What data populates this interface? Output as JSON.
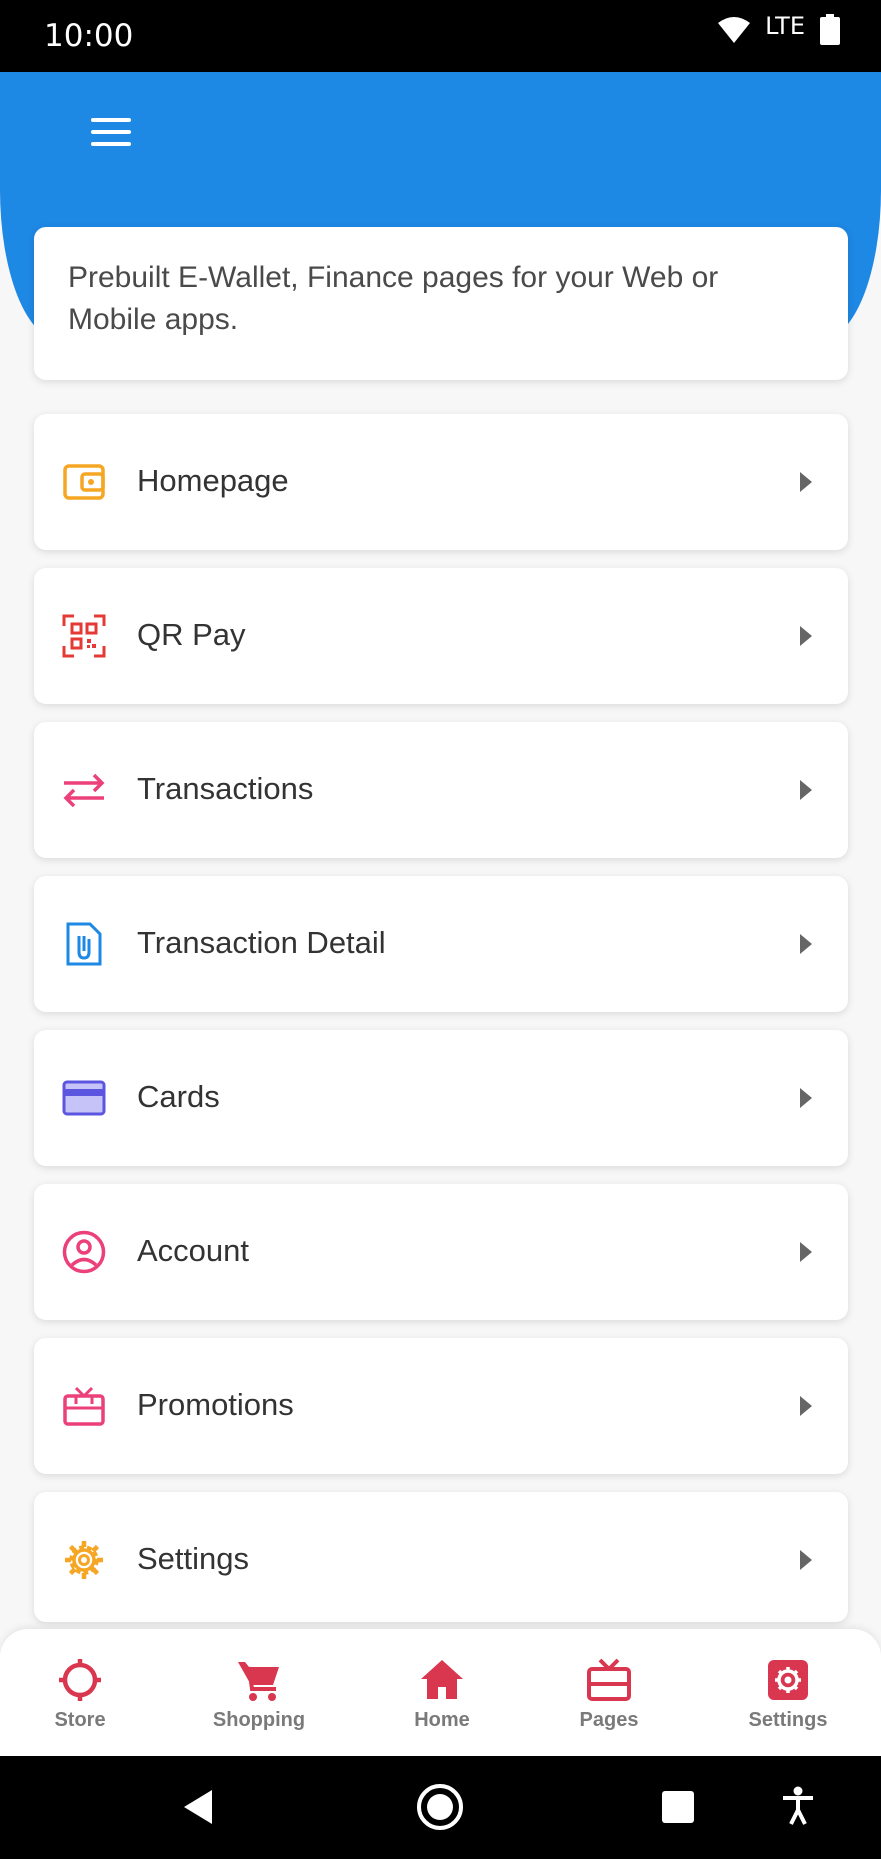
{
  "status_bar": {
    "time": "10:00",
    "network": "LTE"
  },
  "intro": {
    "text": "Prebuilt E-Wallet, Finance pages for your Web or Mobile apps."
  },
  "menu": {
    "items": [
      {
        "label": "Homepage",
        "icon": "wallet-icon",
        "color": "#f5a623"
      },
      {
        "label": "QR Pay",
        "icon": "qr-code-icon",
        "color": "#e53935"
      },
      {
        "label": "Transactions",
        "icon": "transfer-arrows-icon",
        "color": "#ec407a"
      },
      {
        "label": "Transaction Detail",
        "icon": "document-clip-icon",
        "color": "#1e88e5"
      },
      {
        "label": "Cards",
        "icon": "credit-card-icon",
        "color": "#5c55e0"
      },
      {
        "label": "Account",
        "icon": "user-circle-icon",
        "color": "#ec407a"
      },
      {
        "label": "Promotions",
        "icon": "gift-icon",
        "color": "#ec407a"
      },
      {
        "label": "Settings",
        "icon": "gear-icon",
        "color": "#f5a623"
      }
    ]
  },
  "bottom_nav": {
    "accent": "#d9364f",
    "items": [
      {
        "label": "Store",
        "icon": "target-icon"
      },
      {
        "label": "Shopping",
        "icon": "cart-icon"
      },
      {
        "label": "Home",
        "icon": "home-icon"
      },
      {
        "label": "Pages",
        "icon": "gift-box-icon"
      },
      {
        "label": "Settings",
        "icon": "settings-cog-icon"
      }
    ]
  },
  "colors": {
    "app_bar": "#1e88e5",
    "text": "#333333"
  }
}
